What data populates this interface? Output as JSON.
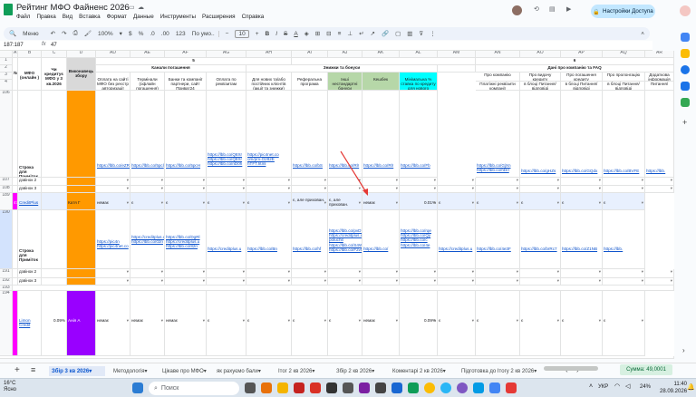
{
  "doc": {
    "title": "Рейтинг МФО Файненс 2026",
    "share": "Настройки Доступа"
  },
  "menus": [
    "Файл",
    "Правка",
    "Вид",
    "Вставка",
    "Формат",
    "Данные",
    "Инструменты",
    "Расширения",
    "Справка"
  ],
  "toolbar": {
    "search": "Меню",
    "zoom": "100%",
    "font_size": "10",
    "number_format": "123",
    "decimals_dec": ".0",
    "decimals_inc": ".00"
  },
  "formula_bar": {
    "cell_ref": "187:187",
    "value": "47"
  },
  "columns": [
    {
      "l": "A"
    },
    {
      "l": "B"
    },
    {
      "l": "C"
    },
    {
      "l": "D"
    },
    {
      "l": "AD"
    },
    {
      "l": "AE"
    },
    {
      "l": "AF"
    },
    {
      "l": "AG"
    },
    {
      "l": "AH"
    },
    {
      "l": "AI"
    },
    {
      "l": "AJ"
    },
    {
      "l": "AK"
    },
    {
      "l": "AL"
    },
    {
      "l": "AM"
    },
    {
      "l": "AN"
    },
    {
      "l": "AO"
    },
    {
      "l": "AP"
    },
    {
      "l": "AQ"
    },
    {
      "l": "AR"
    }
  ],
  "rows": [
    "1",
    "2",
    "3",
    "4",
    "106",
    "107",
    "108",
    "189",
    "190",
    "191",
    "192",
    "193",
    "194"
  ],
  "header": {
    "group_row1_AI": "5",
    "group_row1_AN": "6",
    "channels": "Канали погашення",
    "discounts": "Знижки та бонуси",
    "company_data": "Дані про компанію та FAQ",
    "col_n": "№",
    "col_mfo": "МФО (онлайн )",
    "col_c": "Чи кредитує МФО у 3 кв.2026",
    "col_d": "Виконавець збору",
    "ad": "Оплата на сайті МФО без реєстр авторизації",
    "ae": "Термінали (офлайн погашення)",
    "af": "Банки та компанії партнери, сайт Приват24",
    "ag": "Оплата по реквізитам",
    "ah": "Для нових та/або постійних клієнтів (акції та знижки)",
    "ai": "Реферальна програма",
    "aj": "Інші нестандартні бонуси",
    "ak": "Кешбек",
    "al": "Мінімальна % ставка по кредиту для нового клієнта",
    "am": "Про компанію",
    "an": "Про видачу кредиту",
    "ao": "Про погашення кредиту",
    "ap": "Про пролонгацію",
    "aq": "Додаткова інформація (Питання)",
    "am_sub": "Платіжні реквізити компанії",
    "an_sub": "в блоці Питання/відповіді",
    "ao_sub": "в блоці Питання/відповіді",
    "ap_sub": "в блоці Питання/відповіді",
    "aq_sub": "Питання/"
  },
  "block1": {
    "label": "Строка для Приміток",
    "r107": "дзвінок 2",
    "r108": "дзвінок 3",
    "ad": "https://lbb.co/eZR",
    "ae": "https://lbb.co/5pcl",
    "af": "https://lbb.co/5pcH",
    "ag": "https://lbb.co/Q8Xr",
    "ag2": "https://lbb.co/Q8Xr",
    "ag3": "https://lbb.co/nD0h",
    "ah": "https://pic4net.co",
    "ah2": "om/pm-O282E",
    "ah3": "hTFT.html",
    "ai": "https://lbb.co/bS",
    "aj": "https://lbb.co/Rlr",
    "ak": "https://lbb.co/Rlr",
    "al": "https://lbb.co/Fb",
    "am1": "https://lbb.co/GjXn",
    "am2": "https://lbb.co/hDrl",
    "an": "https://lbb.co/gHZs",
    "ao": "https://lbb.co/GQdx",
    "ap": "https://lbb.co/BVFE",
    "aq": "https://lbb."
  },
  "credit_row": {
    "n": "47",
    "mfo": "CreditPlus",
    "d": "Катя Г",
    "ad": "немає",
    "ae": "є",
    "af": "є",
    "ag": "є",
    "ah": "є",
    "ai": "є, але прихован.",
    "aj": "є, але прихован.",
    "ak": "немає",
    "al": "0.01%",
    "am": "є",
    "an": "є",
    "ao": "є",
    "ap": "є",
    "aq": "є"
  },
  "block2": {
    "label": "Строка для Приміток",
    "r191": "дзвінок 2",
    "r192": "дзвінок 3",
    "ad1": "https://pic4n",
    "ad2": "https://pic4net.co",
    "ae1": "https://creditplus.u",
    "ae2": "https://lbb.co/02ri",
    "af1": "https://lbb.co/DgRl",
    "af2": "https://creditplus.u",
    "af3": "https://lbb.co/82ri",
    "ag": "https://creditplus.u",
    "ah": "https://lbb.co/Bn",
    "ai": "https://lbb.co/hf",
    "aj1": "https://lbb.co/pvD7tM",
    "aj2": "https://creditplus.ua/kak-poluchit",
    "aj3": "https://lbb.co/S4WK4yT",
    "aj4": "https://lbb.co/F2vtz5g9",
    "ak": "https://lbb.co/",
    "al1": "https://lbb.co/rqe",
    "al2": "https://lbb.co/Qy",
    "al3": "https://lbb.co/c",
    "al4": "https://lbb.co/4e",
    "am": "https://creditplus.u",
    "an": "https://lbb.co/4e3F",
    "ao": "https://lbb.co/brRc7",
    "ap": "https://lbb.co/Z1NB",
    "aq": "https://lbb."
  },
  "limon_row": {
    "mfo": "Limon Credit",
    "c": "0.09%",
    "d": "Анія А",
    "ad": "немає",
    "ae": "немає",
    "af": "немає",
    "ag": "є",
    "ah": "є",
    "ai": "є",
    "aj": "є",
    "ak": "немає",
    "al": "0.09%",
    "am": "є",
    "an": "є",
    "ao": "є",
    "ap": "є",
    "aq": "є"
  },
  "tabs": [
    {
      "label": "Збір 3 кв 2026",
      "active": true
    },
    {
      "label": "Методологія"
    },
    {
      "label": "Цікаве про МФО"
    },
    {
      "label": "як рахуємо бали"
    },
    {
      "label": "Ітог 2 кв 2026"
    },
    {
      "label": "Збір 2 кв 2026"
    },
    {
      "label": "Коментарі 2 кв 2026"
    },
    {
      "label": "Підготовка до Ітогу 2 кв 2026"
    }
  ],
  "sum": "Сумма: 49,0001",
  "taskbar": {
    "weather": "16°C",
    "weather_sub": "Ясно",
    "search": "Поиск",
    "lang": "УКР",
    "battery": "24%",
    "time": "11:40",
    "date": "28.09.2026"
  },
  "colors": {
    "orange": "#ff9900",
    "purple": "#9900ff",
    "magenta": "#ff00ff",
    "green": "#b6d7a8",
    "cyan": "#00ffff",
    "select": "#e8f0fe",
    "gray": "#d9d9d9"
  }
}
